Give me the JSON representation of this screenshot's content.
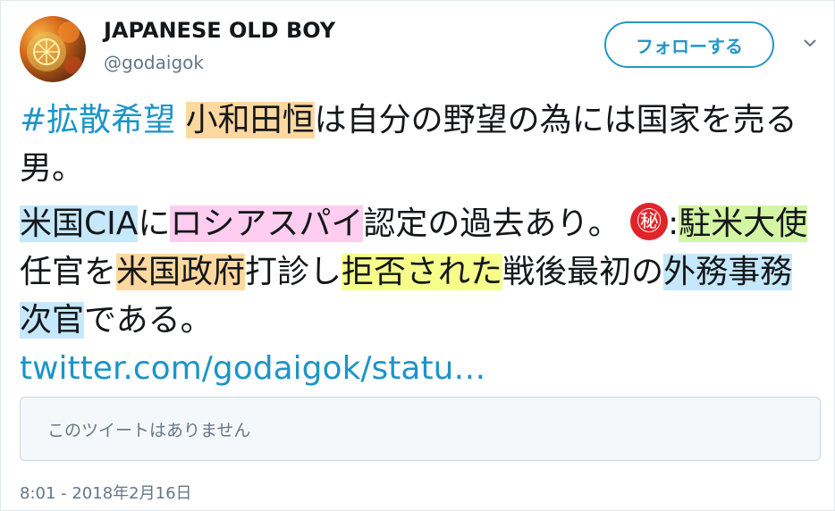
{
  "user": {
    "display_name": "JAPANESE OLD BOY",
    "handle": "@godaigok",
    "avatar_icon": "avatar-photo"
  },
  "header": {
    "follow_label": "フォローする",
    "menu_icon": "chevron-down-icon"
  },
  "tweet": {
    "hashtag": "#拡散希望",
    "space": " ",
    "name_highlight": "小和田恒",
    "line1_rest": "は自分の野望の為には国家を売る男。",
    "us_cia": "米国CIA",
    "ni": "に",
    "russian_spy": "ロシアスパイ",
    "certified": "認定の過去あり。",
    "secret_mark": "㊙",
    "colon": ":",
    "ambassador": "駐米大使",
    "appointed": "任官を",
    "us_gov": "米国政府",
    "sounded": "打診し",
    "rejected": "拒否された",
    "postwar": "戦後最初の",
    "vice_minister": "外務事務次官",
    "dearu": "である。",
    "link": "twitter.com/godaigok/statu…"
  },
  "quote": {
    "unavailable_text": "このツイートはありません"
  },
  "meta": {
    "timestamp": "8:01 - 2018年2月16日"
  },
  "colors": {
    "accent": "#1b95c7",
    "highlight_orange": "#ffd8a0",
    "highlight_blue": "#c6e8fb",
    "highlight_pink": "#ffcdf0",
    "highlight_green": "#d3f5a4",
    "highlight_yellow": "#f6ff8a",
    "secret_red": "#e0252a"
  }
}
